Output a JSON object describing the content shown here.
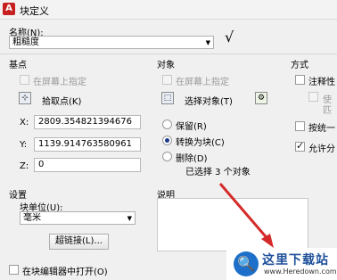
{
  "window": {
    "title": "块定义",
    "app_icon": "A"
  },
  "name": {
    "label": "名称(N):",
    "value": "粗糙度",
    "preview_glyph": "√"
  },
  "base_point": {
    "section": "基点",
    "specify_on_screen": "在屏幕上指定",
    "pick_point": "拾取点(K)",
    "x_label": "X:",
    "x_value": "2809.354821394676",
    "y_label": "Y:",
    "y_value": "1139.914763580961",
    "z_label": "Z:",
    "z_value": "0"
  },
  "objects": {
    "section": "对象",
    "specify_on_screen": "在屏幕上指定",
    "select_objects": "选择对象(T)",
    "retain": "保留(R)",
    "convert_to_block": "转换为块(C)",
    "delete": "删除(D)",
    "selected_count": "已选择 3 个对象"
  },
  "behavior": {
    "section": "方式",
    "annotative": "注释性",
    "match_orientation_1": "使",
    "match_orientation_2": "匹",
    "scale_uniformly": "按统一",
    "allow_exploding": "允许分"
  },
  "settings": {
    "section": "设置",
    "block_unit_label": "块单位(U):",
    "block_unit_value": "毫米",
    "hyperlink_button": "超链接(L)..."
  },
  "description": {
    "label": "说明"
  },
  "open_in_editor": "在块编辑器中打开(O)",
  "watermark": {
    "name": "这里下载站",
    "url": "www.Heredown.com",
    "logo_glyph": "🔍"
  },
  "colors": {
    "arrow": "#d42a2a",
    "watermark_blue": "#1d6fc9"
  }
}
